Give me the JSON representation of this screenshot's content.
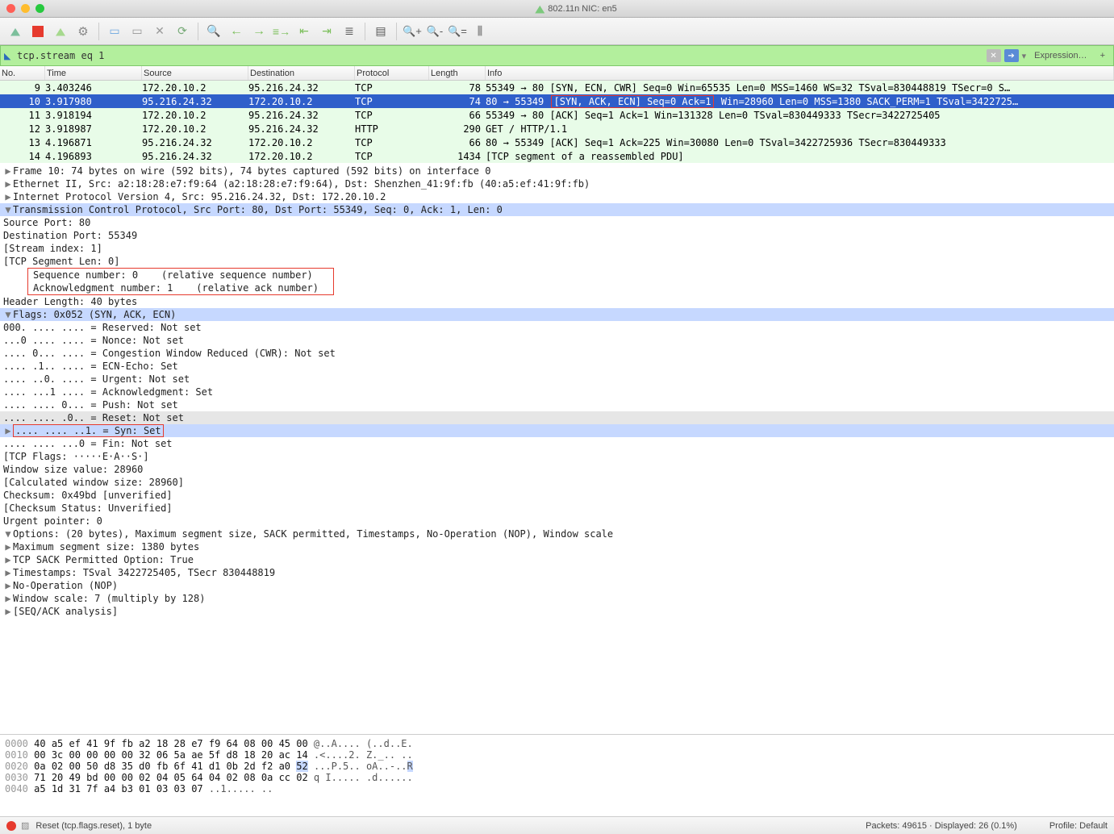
{
  "title": "802.11n NIC: en5",
  "filter": {
    "value": "tcp.stream eq 1",
    "expression_label": "Expression…"
  },
  "columns": {
    "no": "No.",
    "time": "Time",
    "src": "Source",
    "dst": "Destination",
    "proto": "Protocol",
    "len": "Length",
    "info": "Info"
  },
  "packets": [
    {
      "no": "9",
      "time": "3.403246",
      "src": "172.20.10.2",
      "dst": "95.216.24.32",
      "proto": "TCP",
      "len": "78",
      "info": "55349 → 80 [SYN, ECN, CWR] Seq=0 Win=65535 Len=0 MSS=1460 WS=32 TSval=830448819 TSecr=0 S…",
      "cls": "green"
    },
    {
      "no": "10",
      "time": "3.917980",
      "src": "95.216.24.32",
      "dst": "172.20.10.2",
      "proto": "TCP",
      "len": "74",
      "info_pre": "80 → 55349 ",
      "info_box": "[SYN, ACK, ECN] Seq=0 Ack=1",
      "info_post": " Win=28960 Len=0 MSS=1380 SACK_PERM=1 TSval=3422725…",
      "cls": "sel"
    },
    {
      "no": "11",
      "time": "3.918194",
      "src": "172.20.10.2",
      "dst": "95.216.24.32",
      "proto": "TCP",
      "len": "66",
      "info": "55349 → 80 [ACK] Seq=1 Ack=1 Win=131328 Len=0 TSval=830449333 TSecr=3422725405",
      "cls": "green"
    },
    {
      "no": "12",
      "time": "3.918987",
      "src": "172.20.10.2",
      "dst": "95.216.24.32",
      "proto": "HTTP",
      "len": "290",
      "info": "GET / HTTP/1.1",
      "cls": "green"
    },
    {
      "no": "13",
      "time": "4.196871",
      "src": "95.216.24.32",
      "dst": "172.20.10.2",
      "proto": "TCP",
      "len": "66",
      "info": "80 → 55349 [ACK] Seq=1 Ack=225 Win=30080 Len=0 TSval=3422725936 TSecr=830449333",
      "cls": "green"
    },
    {
      "no": "14",
      "time": "4.196893",
      "src": "95.216.24.32",
      "dst": "172.20.10.2",
      "proto": "TCP",
      "len": "1434",
      "info": "[TCP segment of a reassembled PDU]",
      "cls": "green"
    }
  ],
  "details": {
    "frame": "Frame 10: 74 bytes on wire (592 bits), 74 bytes captured (592 bits) on interface 0",
    "eth": "Ethernet II, Src: a2:18:28:e7:f9:64 (a2:18:28:e7:f9:64), Dst: Shenzhen_41:9f:fb (40:a5:ef:41:9f:fb)",
    "ip": "Internet Protocol Version 4, Src: 95.216.24.32, Dst: 172.20.10.2",
    "tcp": "Transmission Control Protocol, Src Port: 80, Dst Port: 55349, Seq: 0, Ack: 1, Len: 0",
    "src_port": "Source Port: 80",
    "dst_port": "Destination Port: 55349",
    "stream_idx": "[Stream index: 1]",
    "seg_len": "[TCP Segment Len: 0]",
    "seq": "Sequence number: 0    (relative sequence number)",
    "ack": "Acknowledgment number: 1    (relative ack number)",
    "hdr_len": "Header Length: 40 bytes",
    "flags": "Flags: 0x052 (SYN, ACK, ECN)",
    "f_reserved": "000. .... .... = Reserved: Not set",
    "f_nonce": "...0 .... .... = Nonce: Not set",
    "f_cwr": ".... 0... .... = Congestion Window Reduced (CWR): Not set",
    "f_ece": ".... .1.. .... = ECN-Echo: Set",
    "f_urg": ".... ..0. .... = Urgent: Not set",
    "f_ack": ".... ...1 .... = Acknowledgment: Set",
    "f_psh": ".... .... 0... = Push: Not set",
    "f_rst": ".... .... .0.. = Reset: Not set",
    "f_syn": ".... .... ..1. = Syn: Set",
    "f_fin": ".... .... ...0 = Fin: Not set",
    "f_str": "[TCP Flags: ·····E·A··S·]",
    "win": "Window size value: 28960",
    "cwin": "[Calculated window size: 28960]",
    "cksum": "Checksum: 0x49bd [unverified]",
    "cksum_st": "[Checksum Status: Unverified]",
    "urg_ptr": "Urgent pointer: 0",
    "opts": "Options: (20 bytes), Maximum segment size, SACK permitted, Timestamps, No-Operation (NOP), Window scale",
    "opt_mss": "Maximum segment size: 1380 bytes",
    "opt_sack": "TCP SACK Permitted Option: True",
    "opt_ts": "Timestamps: TSval 3422725405, TSecr 830448819",
    "opt_nop": "No-Operation (NOP)",
    "opt_ws": "Window scale: 7 (multiply by 128)",
    "seqack": "[SEQ/ACK analysis]"
  },
  "hex": {
    "rows": [
      {
        "off": "0000",
        "hex": "40 a5 ef 41 9f fb a2 18  28 e7 f9 64 08 00 45 00",
        "asc": "@..A.... (..d..E."
      },
      {
        "off": "0010",
        "hex": "00 3c 00 00 00 00 32 06  5a ae 5f d8 18 20 ac 14",
        "asc": ".<....2. Z._.. .."
      },
      {
        "off": "0020",
        "hex": "0a 02 00 50 d8 35 d0 fb  6f 41 d1 0b 2d f2 a0 52",
        "asc": "...P.5.. oA..-..R",
        "sel": true
      },
      {
        "off": "0030",
        "hex": "71 20 49 bd 00 00 02 04  05 64 04 02 08 0a cc 02",
        "asc": "q I..... .d......"
      },
      {
        "off": "0040",
        "hex": "a5 1d 31 7f a4 b3 01 03  03 07",
        "asc": "..1..... .."
      }
    ]
  },
  "status": {
    "field": "Reset (tcp.flags.reset), 1 byte",
    "counts": "Packets: 49615 · Displayed: 26 (0.1%)",
    "profile": "Profile: Default"
  }
}
